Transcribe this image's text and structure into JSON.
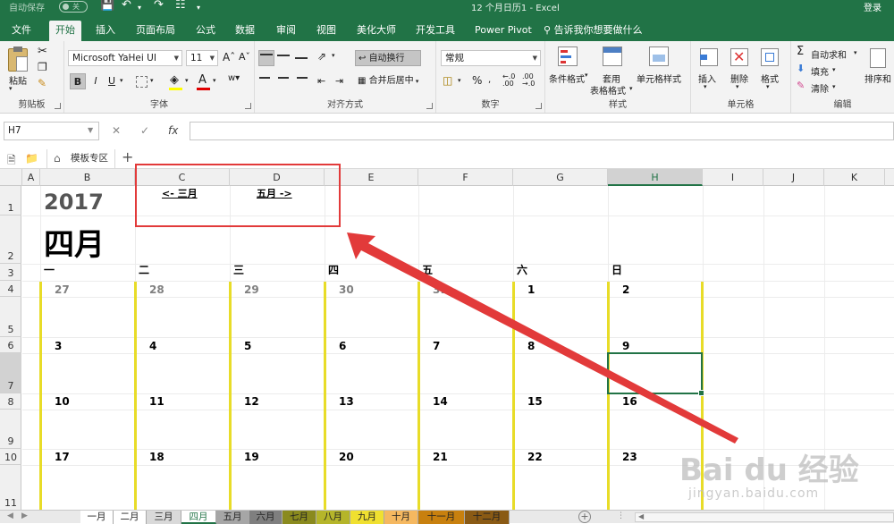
{
  "window": {
    "autosave_label": "自动保存",
    "autosave_state": "关",
    "document_title": "12 个月日历1  -  Excel",
    "login_label": "登录"
  },
  "menu_tabs": [
    {
      "label": "文件"
    },
    {
      "label": "开始"
    },
    {
      "label": "插入"
    },
    {
      "label": "页面布局"
    },
    {
      "label": "公式"
    },
    {
      "label": "数据"
    },
    {
      "label": "审阅"
    },
    {
      "label": "视图"
    },
    {
      "label": "美化大师"
    },
    {
      "label": "开发工具"
    },
    {
      "label": "Power Pivot"
    }
  ],
  "tell_me": "告诉我你想要做什么",
  "ribbon": {
    "clipboard": {
      "paste": "粘贴",
      "label": "剪贴板"
    },
    "font": {
      "name": "Microsoft YaHei UI",
      "size": "11",
      "label": "字体",
      "bold": "B",
      "italic": "I",
      "underline": "U"
    },
    "alignment": {
      "wrap_text": "自动换行",
      "merge_center": "合并后居中",
      "label": "对齐方式"
    },
    "number": {
      "format": "常规",
      "percent": "%",
      "label": "数字"
    },
    "styles": {
      "conditional": "条件格式",
      "table_line1": "套用",
      "table_line2": "表格格式",
      "cell_styles": "单元格样式",
      "label": "样式"
    },
    "cells": {
      "insert": "插入",
      "delete": "删除",
      "format": "格式",
      "label": "单元格"
    },
    "editing": {
      "autosum": "自动求和",
      "fill": "填充",
      "clear": "清除",
      "sort": "排序和",
      "label": "编辑"
    }
  },
  "formula_bar": {
    "name_box": "H7",
    "cancel": "✕",
    "enter": "✓",
    "fx": "fx"
  },
  "workbook_tab": "模板专区",
  "columns": [
    "A",
    "B",
    "C",
    "D",
    "E",
    "F",
    "G",
    "H",
    "I",
    "J",
    "K"
  ],
  "rows": [
    "1",
    "2",
    "3",
    "4",
    "5",
    "6",
    "7",
    "8",
    "9",
    "10",
    "11"
  ],
  "calendar": {
    "year": "2017",
    "month": "四月",
    "prev_link": "<- 三月",
    "next_link": "五月 ->",
    "weekdays": [
      "一",
      "二",
      "三",
      "四",
      "五",
      "六",
      "日"
    ],
    "weeks": [
      [
        {
          "d": "27",
          "dim": true
        },
        {
          "d": "28",
          "dim": true
        },
        {
          "d": "29",
          "dim": true
        },
        {
          "d": "30",
          "dim": true
        },
        {
          "d": "31",
          "dim": true
        },
        {
          "d": "1",
          "dim": false
        },
        {
          "d": "2",
          "dim": false
        }
      ],
      [
        {
          "d": "3"
        },
        {
          "d": "4"
        },
        {
          "d": "5"
        },
        {
          "d": "6"
        },
        {
          "d": "7"
        },
        {
          "d": "8"
        },
        {
          "d": "9"
        }
      ],
      [
        {
          "d": "10"
        },
        {
          "d": "11"
        },
        {
          "d": "12"
        },
        {
          "d": "13"
        },
        {
          "d": "14"
        },
        {
          "d": "15"
        },
        {
          "d": "16"
        }
      ],
      [
        {
          "d": "17"
        },
        {
          "d": "18"
        },
        {
          "d": "19"
        },
        {
          "d": "20"
        },
        {
          "d": "21"
        },
        {
          "d": "22"
        },
        {
          "d": "23"
        }
      ]
    ]
  },
  "sheets": [
    {
      "label": "一月",
      "color": "#ffffff"
    },
    {
      "label": "二月",
      "color": "#ffffff"
    },
    {
      "label": "三月",
      "color": "#d9d9d9"
    },
    {
      "label": "四月",
      "color": "#ffffff",
      "active": true
    },
    {
      "label": "五月",
      "color": "#a6a6a6"
    },
    {
      "label": "六月",
      "color": "#7f7f7f"
    },
    {
      "label": "七月",
      "color": "#8a8a1e"
    },
    {
      "label": "八月",
      "color": "#b5b52a"
    },
    {
      "label": "九月",
      "color": "#f0e030"
    },
    {
      "label": "十月",
      "color": "#f5b860"
    },
    {
      "label": "十一月",
      "color": "#c8800e"
    },
    {
      "label": "十二月",
      "color": "#8a5a14"
    }
  ],
  "watermark": {
    "logo": "Bai du 经验",
    "url": "jingyan.baidu.com"
  },
  "colors": {
    "excel_green": "#217346",
    "annotation_red": "#e23a3a",
    "calendar_yellow": "#e8dc28"
  }
}
